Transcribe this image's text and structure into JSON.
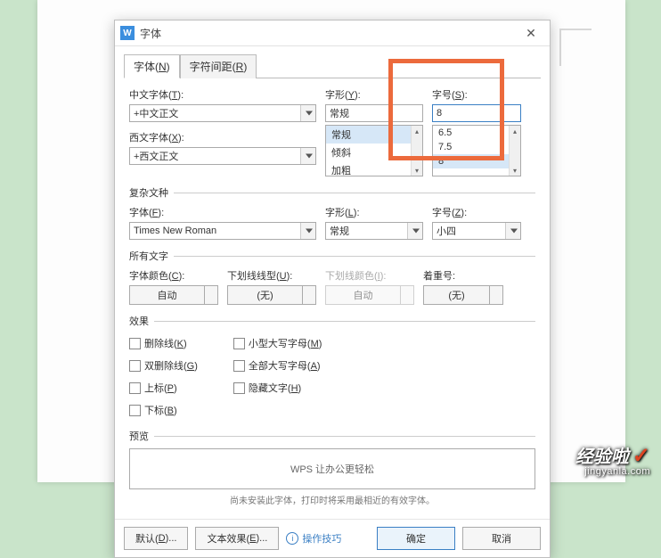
{
  "window": {
    "title": "字体",
    "icon_letter": "W"
  },
  "tabs": {
    "font": {
      "label": "字体(",
      "hotkey": "N",
      "suffix": ")"
    },
    "spacing": {
      "label": "字符间距(",
      "hotkey": "R",
      "suffix": ")"
    }
  },
  "main": {
    "cn_font_label": "中文字体(",
    "cn_font_hotkey": "T",
    "cn_font_suffix": "):",
    "cn_font_value": "+中文正文",
    "style_label": "字形(",
    "style_hotkey": "Y",
    "style_suffix": "):",
    "style_value": "常规",
    "style_options": [
      "常规",
      "倾斜",
      "加粗"
    ],
    "size_label": "字号(",
    "size_hotkey": "S",
    "size_suffix": "):",
    "size_value": "8",
    "size_options": [
      "6.5",
      "7.5",
      "8"
    ],
    "west_font_label": "西文字体(",
    "west_font_hotkey": "X",
    "west_font_suffix": "):",
    "west_font_value": "+西文正文"
  },
  "complex": {
    "group_label": "复杂文种",
    "font_label": "字体(",
    "font_hotkey": "F",
    "font_suffix": "):",
    "font_value": "Times New Roman",
    "style_label": "字形(",
    "style_hotkey": "L",
    "style_suffix": "):",
    "style_value": "常规",
    "size_label": "字号(",
    "size_hotkey": "Z",
    "size_suffix": "):",
    "size_value": "小四"
  },
  "alltext": {
    "group_label": "所有文字",
    "color_label": "字体颜色(",
    "color_hotkey": "C",
    "color_suffix": "):",
    "color_value": "自动",
    "ul_label": "下划线线型(",
    "ul_hotkey": "U",
    "ul_suffix": "):",
    "ul_value": "(无)",
    "ulc_label": "下划线颜色(",
    "ulc_hotkey": "I",
    "ulc_suffix": "):",
    "ulc_value": "自动",
    "em_label": "着重号:",
    "em_value": "(无)"
  },
  "effects": {
    "group_label": "效果",
    "strike": "删除线(",
    "strike_h": "K",
    "strike_s": ")",
    "dstrike": "双删除线(",
    "dstrike_h": "G",
    "dstrike_s": ")",
    "super": "上标(",
    "super_h": "P",
    "super_s": ")",
    "sub": "下标(",
    "sub_h": "B",
    "sub_s": ")",
    "smallcaps": "小型大写字母(",
    "smallcaps_h": "M",
    "smallcaps_s": ")",
    "allcaps": "全部大写字母(",
    "allcaps_h": "A",
    "allcaps_s": ")",
    "hidden": "隐藏文字(",
    "hidden_h": "H",
    "hidden_s": ")"
  },
  "preview": {
    "group_label": "预览",
    "text": "WPS 让办公更轻松",
    "note": "尚未安装此字体，打印时将采用最相近的有效字体。"
  },
  "buttons": {
    "default": "默认(",
    "default_h": "D",
    "default_s": ")...",
    "texteffect": "文本效果(",
    "texteffect_h": "E",
    "texteffect_s": ")...",
    "tips": "操作技巧",
    "ok": "确定",
    "cancel": "取消"
  },
  "watermark": {
    "brand": "经验啦",
    "url": "jingyanla.com"
  }
}
